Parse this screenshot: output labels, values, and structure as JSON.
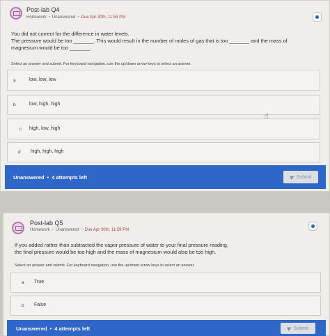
{
  "q4": {
    "title": "Post-lab Q4",
    "status": "Homework",
    "state": "Unanswered",
    "due": "Due Apr 30th, 11:59 PM",
    "text1": "You did not correct for the difference in water levels.",
    "text2": "The pressure would be too _______. This would result in the number of moles of gas that is too _______ and the mass of",
    "text3": "magnesium would be too _______.",
    "instructions": "Select an answer and submit. For keyboard navigation, use the up/down arrow keys to select an answer.",
    "options": [
      {
        "letter": "a",
        "text": "low, low, low"
      },
      {
        "letter": "b",
        "text": "low, high, high"
      },
      {
        "letter": "c",
        "text": "high, low, high"
      },
      {
        "letter": "d",
        "text": "high, high, high"
      }
    ],
    "footer_state": "Unanswered",
    "attempts": "4 attempts left",
    "submit": "Submit"
  },
  "q5": {
    "title": "Post-lab Q5",
    "status": "Homework",
    "state": "Unanswered",
    "due": "Due Apr 30th, 11:59 PM",
    "text1": "If you added rather than subtracted the vapor pressure of water to your final pressure reading,",
    "text2": "the final pressure would be too high and the mass of magnesium would also be too high.",
    "instructions": "Select an answer and submit. For keyboard navigation, use the up/down arrow keys to select an answer.",
    "options": [
      {
        "letter": "a",
        "text": "True"
      },
      {
        "letter": "b",
        "text": "False"
      }
    ],
    "footer_state": "Unanswered",
    "attempts": "4 attempts left",
    "submit": "Submit"
  },
  "colors": {
    "accent": "#2f67c9",
    "due": "#b0473f",
    "icon": "#b277ac"
  }
}
